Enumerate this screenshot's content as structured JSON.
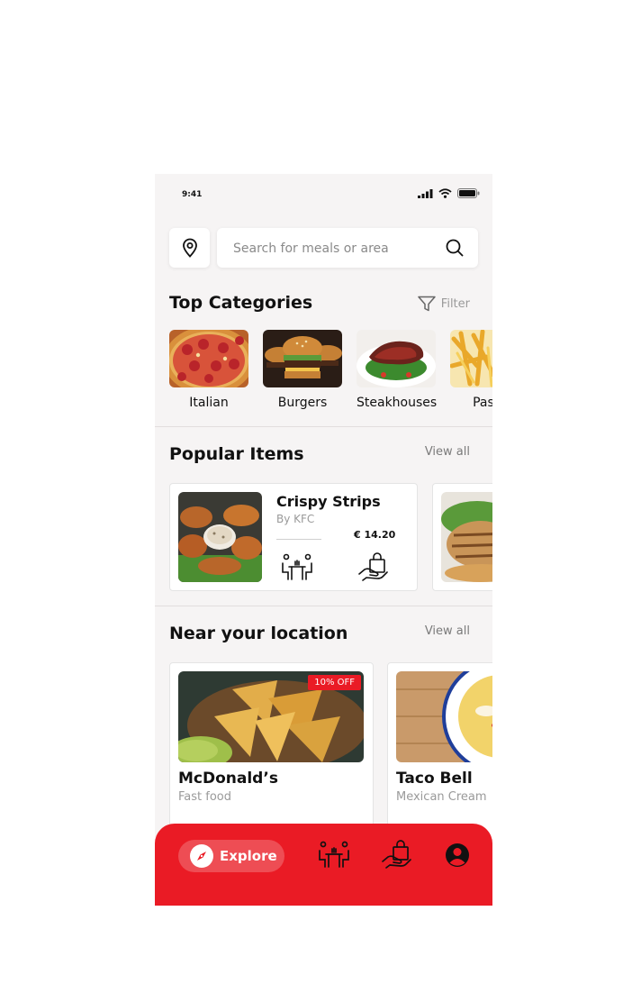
{
  "status_bar": {
    "time": "9:41"
  },
  "search": {
    "placeholder": "Search for meals or area"
  },
  "categories": {
    "title": "Top Categories",
    "filter_label": "Filter",
    "items": [
      {
        "label": "Italian"
      },
      {
        "label": "Burgers"
      },
      {
        "label": "Steakhouses"
      },
      {
        "label": "Pasta"
      }
    ]
  },
  "popular": {
    "title": "Popular Items",
    "view_all": "View all",
    "items": [
      {
        "name": "Crispy Strips",
        "by": "By KFC",
        "price": "€ 14.20"
      }
    ]
  },
  "near": {
    "title": "Near your location",
    "view_all": "View all",
    "items": [
      {
        "name": "McDonald’s",
        "subtitle": "Fast food",
        "badge": "10% OFF"
      },
      {
        "name": "Taco Bell",
        "subtitle": "Mexican Cream"
      }
    ]
  },
  "bottom_nav": {
    "explore_label": "Explore",
    "accent_color": "#ea1b25",
    "icons": [
      "compass-icon",
      "dine-in-icon",
      "takeaway-icon",
      "profile-icon"
    ]
  }
}
